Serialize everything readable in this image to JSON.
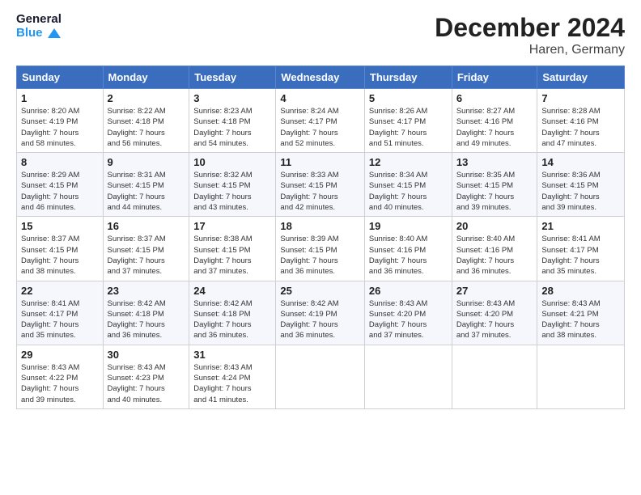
{
  "logo": {
    "text_general": "General",
    "text_blue": "Blue"
  },
  "title": "December 2024",
  "subtitle": "Haren, Germany",
  "days_header": [
    "Sunday",
    "Monday",
    "Tuesday",
    "Wednesday",
    "Thursday",
    "Friday",
    "Saturday"
  ],
  "weeks": [
    [
      {
        "day": "1",
        "info": "Sunrise: 8:20 AM\nSunset: 4:19 PM\nDaylight: 7 hours\nand 58 minutes."
      },
      {
        "day": "2",
        "info": "Sunrise: 8:22 AM\nSunset: 4:18 PM\nDaylight: 7 hours\nand 56 minutes."
      },
      {
        "day": "3",
        "info": "Sunrise: 8:23 AM\nSunset: 4:18 PM\nDaylight: 7 hours\nand 54 minutes."
      },
      {
        "day": "4",
        "info": "Sunrise: 8:24 AM\nSunset: 4:17 PM\nDaylight: 7 hours\nand 52 minutes."
      },
      {
        "day": "5",
        "info": "Sunrise: 8:26 AM\nSunset: 4:17 PM\nDaylight: 7 hours\nand 51 minutes."
      },
      {
        "day": "6",
        "info": "Sunrise: 8:27 AM\nSunset: 4:16 PM\nDaylight: 7 hours\nand 49 minutes."
      },
      {
        "day": "7",
        "info": "Sunrise: 8:28 AM\nSunset: 4:16 PM\nDaylight: 7 hours\nand 47 minutes."
      }
    ],
    [
      {
        "day": "8",
        "info": "Sunrise: 8:29 AM\nSunset: 4:15 PM\nDaylight: 7 hours\nand 46 minutes."
      },
      {
        "day": "9",
        "info": "Sunrise: 8:31 AM\nSunset: 4:15 PM\nDaylight: 7 hours\nand 44 minutes."
      },
      {
        "day": "10",
        "info": "Sunrise: 8:32 AM\nSunset: 4:15 PM\nDaylight: 7 hours\nand 43 minutes."
      },
      {
        "day": "11",
        "info": "Sunrise: 8:33 AM\nSunset: 4:15 PM\nDaylight: 7 hours\nand 42 minutes."
      },
      {
        "day": "12",
        "info": "Sunrise: 8:34 AM\nSunset: 4:15 PM\nDaylight: 7 hours\nand 40 minutes."
      },
      {
        "day": "13",
        "info": "Sunrise: 8:35 AM\nSunset: 4:15 PM\nDaylight: 7 hours\nand 39 minutes."
      },
      {
        "day": "14",
        "info": "Sunrise: 8:36 AM\nSunset: 4:15 PM\nDaylight: 7 hours\nand 39 minutes."
      }
    ],
    [
      {
        "day": "15",
        "info": "Sunrise: 8:37 AM\nSunset: 4:15 PM\nDaylight: 7 hours\nand 38 minutes."
      },
      {
        "day": "16",
        "info": "Sunrise: 8:37 AM\nSunset: 4:15 PM\nDaylight: 7 hours\nand 37 minutes."
      },
      {
        "day": "17",
        "info": "Sunrise: 8:38 AM\nSunset: 4:15 PM\nDaylight: 7 hours\nand 37 minutes."
      },
      {
        "day": "18",
        "info": "Sunrise: 8:39 AM\nSunset: 4:15 PM\nDaylight: 7 hours\nand 36 minutes."
      },
      {
        "day": "19",
        "info": "Sunrise: 8:40 AM\nSunset: 4:16 PM\nDaylight: 7 hours\nand 36 minutes."
      },
      {
        "day": "20",
        "info": "Sunrise: 8:40 AM\nSunset: 4:16 PM\nDaylight: 7 hours\nand 36 minutes."
      },
      {
        "day": "21",
        "info": "Sunrise: 8:41 AM\nSunset: 4:17 PM\nDaylight: 7 hours\nand 35 minutes."
      }
    ],
    [
      {
        "day": "22",
        "info": "Sunrise: 8:41 AM\nSunset: 4:17 PM\nDaylight: 7 hours\nand 35 minutes."
      },
      {
        "day": "23",
        "info": "Sunrise: 8:42 AM\nSunset: 4:18 PM\nDaylight: 7 hours\nand 36 minutes."
      },
      {
        "day": "24",
        "info": "Sunrise: 8:42 AM\nSunset: 4:18 PM\nDaylight: 7 hours\nand 36 minutes."
      },
      {
        "day": "25",
        "info": "Sunrise: 8:42 AM\nSunset: 4:19 PM\nDaylight: 7 hours\nand 36 minutes."
      },
      {
        "day": "26",
        "info": "Sunrise: 8:43 AM\nSunset: 4:20 PM\nDaylight: 7 hours\nand 37 minutes."
      },
      {
        "day": "27",
        "info": "Sunrise: 8:43 AM\nSunset: 4:20 PM\nDaylight: 7 hours\nand 37 minutes."
      },
      {
        "day": "28",
        "info": "Sunrise: 8:43 AM\nSunset: 4:21 PM\nDaylight: 7 hours\nand 38 minutes."
      }
    ],
    [
      {
        "day": "29",
        "info": "Sunrise: 8:43 AM\nSunset: 4:22 PM\nDaylight: 7 hours\nand 39 minutes."
      },
      {
        "day": "30",
        "info": "Sunrise: 8:43 AM\nSunset: 4:23 PM\nDaylight: 7 hours\nand 40 minutes."
      },
      {
        "day": "31",
        "info": "Sunrise: 8:43 AM\nSunset: 4:24 PM\nDaylight: 7 hours\nand 41 minutes."
      },
      null,
      null,
      null,
      null
    ]
  ]
}
